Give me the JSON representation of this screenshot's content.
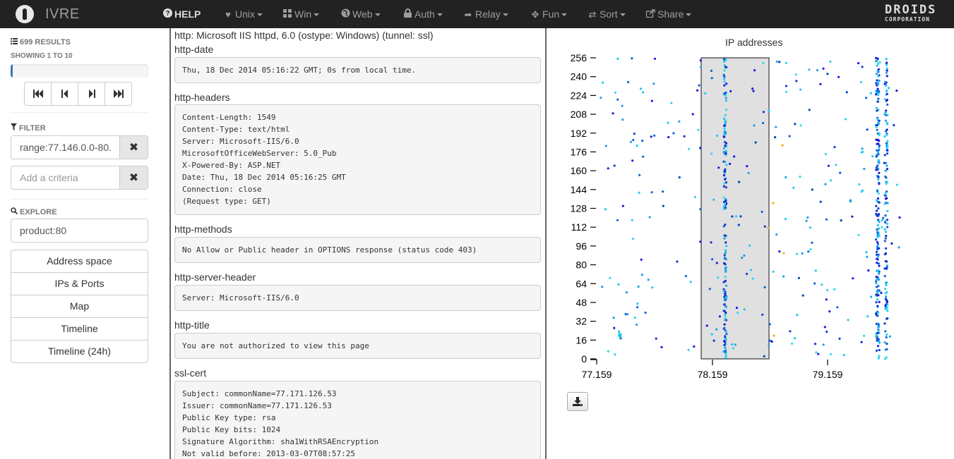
{
  "navbar": {
    "brand": "IVRE",
    "items": [
      {
        "label": "HELP",
        "icon": "question-circle-icon"
      },
      {
        "label": "Unix",
        "icon": "heart-icon"
      },
      {
        "label": "Win",
        "icon": "windows-grid-icon"
      },
      {
        "label": "Web",
        "icon": "globe-icon"
      },
      {
        "label": "Auth",
        "icon": "lock-icon"
      },
      {
        "label": "Relay",
        "icon": "share-arrow-icon"
      },
      {
        "label": "Fun",
        "icon": "move-cross-icon"
      },
      {
        "label": "Sort",
        "icon": "random-icon"
      },
      {
        "label": "Share",
        "icon": "share-square-icon"
      }
    ],
    "partner_logo": {
      "line1": "DROIDS",
      "line2": "CORPORATION"
    }
  },
  "results": {
    "count_label": "699 RESULTS",
    "showing_label": "SHOWING 1 TO 10",
    "progress": 0.014
  },
  "pager": [
    "first-page-icon",
    "prev-page-icon",
    "next-page-icon",
    "last-page-icon"
  ],
  "filter": {
    "header": "FILTER",
    "criteria": [
      {
        "value": "range:77.146.0.0-80.",
        "placeholder": ""
      },
      {
        "value": "",
        "placeholder": "Add a criteria"
      }
    ]
  },
  "explore": {
    "header": "EXPLORE",
    "value": "product:80",
    "buttons": [
      "Address space",
      "IPs & Ports",
      "Map",
      "Timeline",
      "Timeline (24h)"
    ]
  },
  "host": {
    "service_line": "http: Microsoft IIS httpd, 6.0 (ostype: Windows) (tunnel: ssl)",
    "scripts": [
      {
        "name": "http-date",
        "output": "Thu, 18 Dec 2014 05:16:22 GMT; 0s from local time."
      },
      {
        "name": "http-headers",
        "output": "Content-Length: 1549\nContent-Type: text/html\nServer: Microsoft-IIS/6.0\nMicrosoftOfficeWebServer: 5.0_Pub\nX-Powered-By: ASP.NET\nDate: Thu, 18 Dec 2014 05:16:25 GMT\nConnection: close\n(Request type: GET)"
      },
      {
        "name": "http-methods",
        "output": "No Allow or Public header in OPTIONS response (status code 403)"
      },
      {
        "name": "http-server-header",
        "output": "Server: Microsoft-IIS/6.0"
      },
      {
        "name": "http-title",
        "output": "You are not authorized to view this page"
      },
      {
        "name": "ssl-cert",
        "output": "Subject: commonName=77.171.126.53\nIssuer: commonName=77.171.126.53\nPublic Key type: rsa\nPublic Key bits: 1024\nSignature Algorithm: sha1WithRSAEncryption\nNot valid before: 2013-03-07T08:57:25"
      }
    ]
  },
  "chart_data": {
    "type": "scatter",
    "title": "IP addresses",
    "xlabel": "",
    "ylabel": "",
    "x_ticks": [
      "77.159",
      "78.159",
      "79.159"
    ],
    "y_ticks": [
      0,
      16,
      32,
      48,
      64,
      80,
      96,
      112,
      128,
      144,
      160,
      176,
      192,
      208,
      224,
      240,
      256
    ],
    "ylim": [
      0,
      256
    ],
    "x_range_label": [
      "77.159",
      "79.159"
    ],
    "selected_range": [
      "78.159",
      "78.75"
    ],
    "colors": {
      "low": "#1a1ae0",
      "mid": "#1ec8f0",
      "high": "#f0b010"
    }
  },
  "download_icon": "download-icon"
}
